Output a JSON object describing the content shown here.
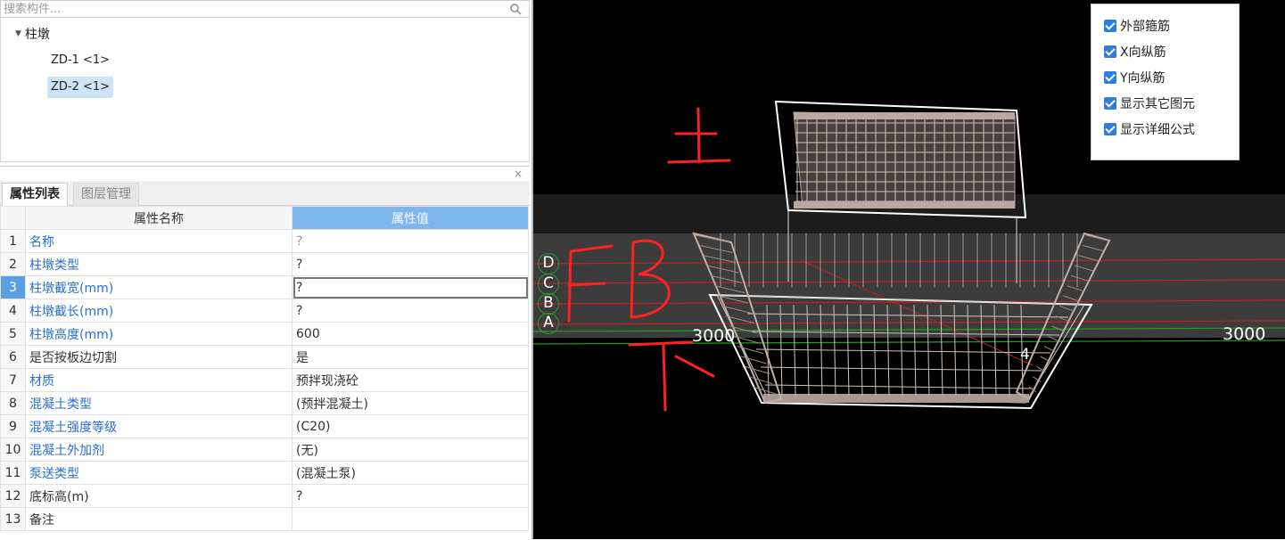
{
  "search": {
    "placeholder": "搜索构件..."
  },
  "tree": {
    "root_label": "柱墩",
    "items": [
      "ZD-1 <1>",
      "ZD-2 <1>"
    ],
    "selected_index": 1
  },
  "panel": {
    "close": "×",
    "tabs": [
      "属性列表",
      "图层管理"
    ],
    "active_tab": 0,
    "columns": [
      "属性名称",
      "属性值"
    ],
    "rows": [
      {
        "num": "1",
        "name": "名称",
        "value": "?"
      },
      {
        "num": "2",
        "name": "柱墩类型",
        "value": "?"
      },
      {
        "num": "3",
        "name": "柱墩截宽(mm)",
        "value": "?"
      },
      {
        "num": "4",
        "name": "柱墩截长(mm)",
        "value": "?"
      },
      {
        "num": "5",
        "name": "柱墩高度(mm)",
        "value": "600"
      },
      {
        "num": "6",
        "name": "是否按板边切割",
        "value": "是"
      },
      {
        "num": "7",
        "name": "材质",
        "value": "预拌现浇砼"
      },
      {
        "num": "8",
        "name": "混凝土类型",
        "value": "(预拌混凝土)"
      },
      {
        "num": "9",
        "name": "混凝土强度等级",
        "value": "(C20)"
      },
      {
        "num": "10",
        "name": "混凝土外加剂",
        "value": "(无)"
      },
      {
        "num": "11",
        "name": "泵送类型",
        "value": "(混凝土泵)"
      },
      {
        "num": "12",
        "name": "底标高(m)",
        "value": "?"
      },
      {
        "num": "13",
        "name": "备注",
        "value": ""
      }
    ],
    "selected_row": 2
  },
  "viewport": {
    "axis_labels": [
      "D",
      "C",
      "B",
      "A"
    ],
    "dimension_left": "3000",
    "dimension_right": "3000",
    "marker": "4",
    "options": [
      {
        "label": "外部箍筋",
        "checked": true
      },
      {
        "label": "X向纵筋",
        "checked": true
      },
      {
        "label": "Y向纵筋",
        "checked": true
      },
      {
        "label": "显示其它图元",
        "checked": true
      },
      {
        "label": "显示详细公式",
        "checked": true
      }
    ]
  },
  "colors": {
    "accent": "#2f7de1",
    "header_blue": "#7db7ee",
    "annotation": "#ff2020",
    "grid_red": "#d02020",
    "grid_green": "#20a020"
  }
}
